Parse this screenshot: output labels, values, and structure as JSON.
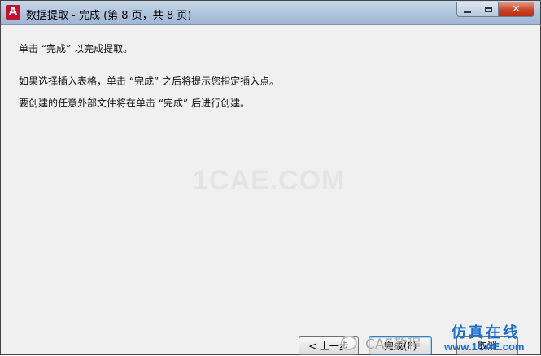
{
  "window": {
    "title": "数据提取 - 完成 (第 8 页，共 8 页)",
    "icon": "autocad-icon",
    "accent_color": "#c8102e"
  },
  "content": {
    "line1": "单击 “完成” 以完成提取。",
    "line2": "如果选择插入表格，单击 “完成” 之后将提示您指定插入点。",
    "line3": "要创建的任意外部文件将在单击 “完成” 后进行创建。"
  },
  "watermark": {
    "center": "1CAE.COM",
    "blog": "CAE教程",
    "cn": "仿真在线",
    "site": "www.1CAE.com"
  },
  "buttons": {
    "back": "< 上一步",
    "finish": "完成(F)",
    "cancel": "取消"
  }
}
